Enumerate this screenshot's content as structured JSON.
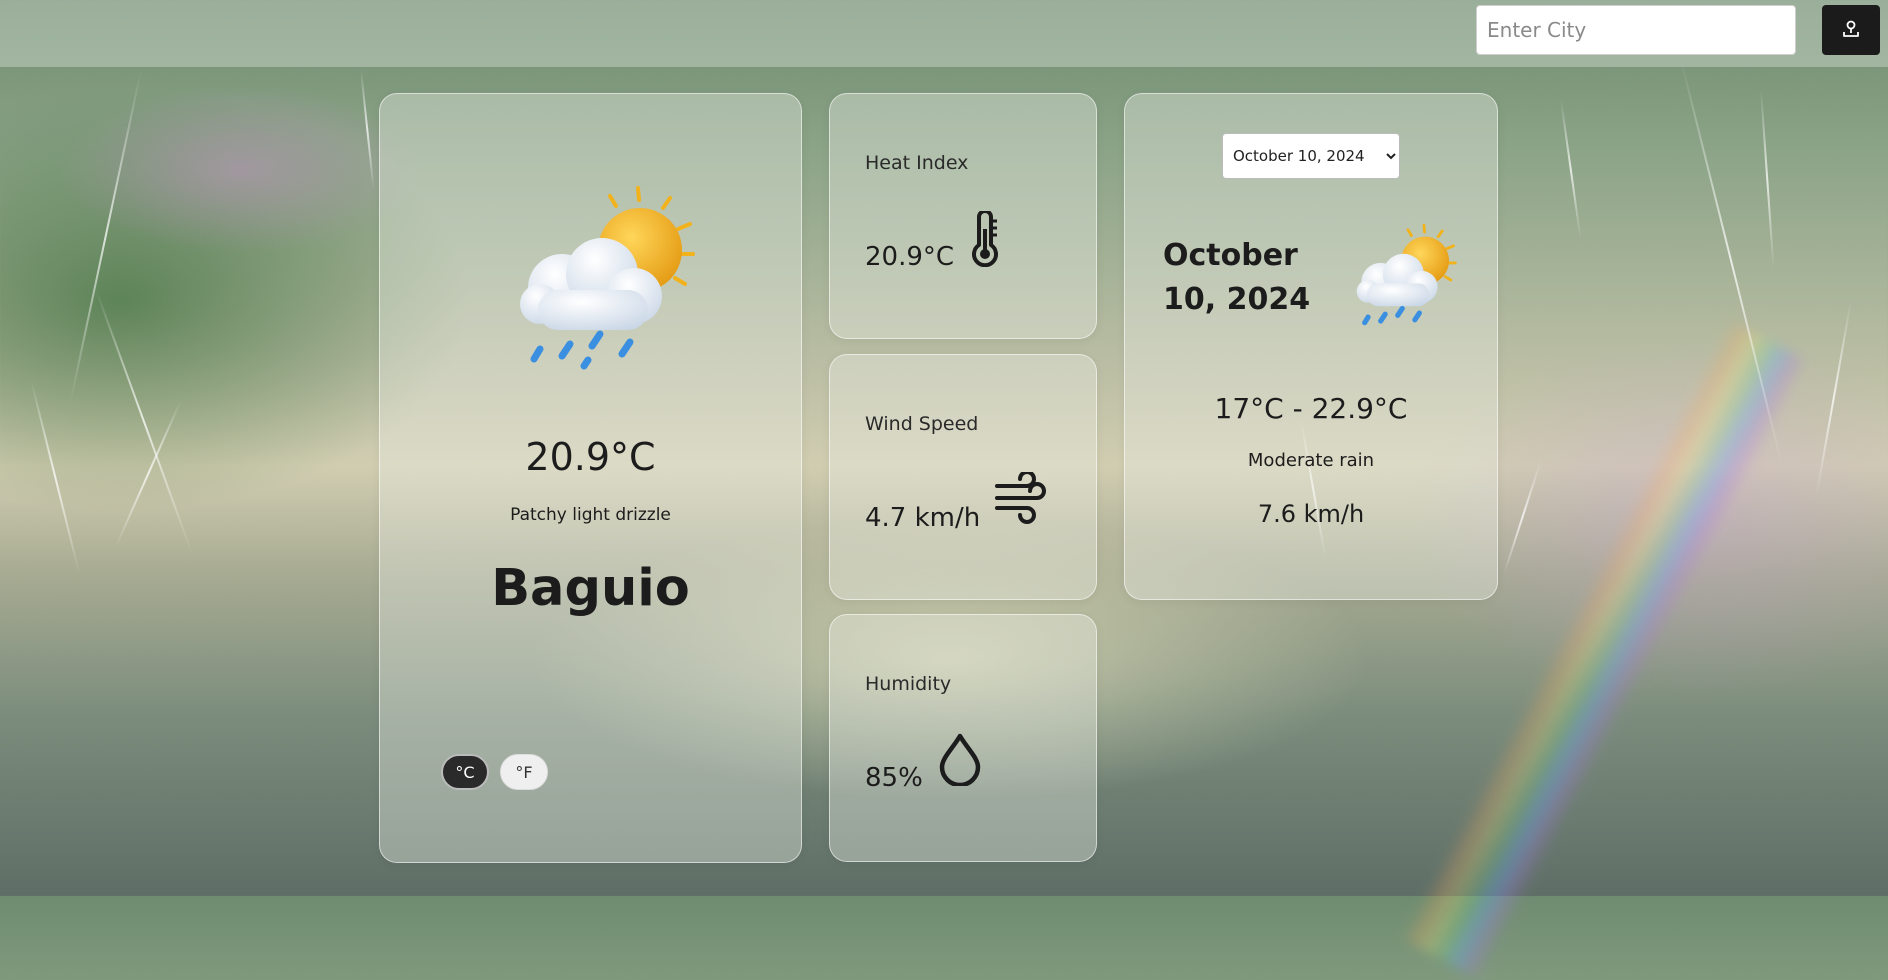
{
  "search": {
    "placeholder": "Enter City"
  },
  "locate_button": {
    "icon": "location-upload-icon"
  },
  "current": {
    "icon": "sun-cloud-rain-icon",
    "temperature": "20.9°C",
    "condition": "Patchy light drizzle",
    "city": "Baguio",
    "units": {
      "celsius": "°C",
      "fahrenheit": "°F",
      "selected": "°C"
    }
  },
  "metrics": {
    "heat_index": {
      "label": "Heat Index",
      "value": "20.9°C",
      "icon": "thermometer-icon"
    },
    "wind_speed": {
      "label": "Wind Speed",
      "value": "4.7 km/h",
      "icon": "wind-icon"
    },
    "humidity": {
      "label": "Humidity",
      "value": "85%",
      "icon": "droplet-icon"
    }
  },
  "forecast": {
    "selected_date": "October 10, 2024",
    "date_options": [
      "October 10, 2024"
    ],
    "date_heading": "October 10, 2024",
    "icon": "sun-cloud-rain-icon",
    "temp_range": "17°C - 22.9°C",
    "condition": "Moderate rain",
    "wind": "7.6 km/h"
  },
  "colors": {
    "dark_button": "#1b1b1b",
    "sun": "#f2b21c",
    "rain": "#3a8fe0",
    "card_bg": "rgba(236,238,232,0.38)"
  }
}
